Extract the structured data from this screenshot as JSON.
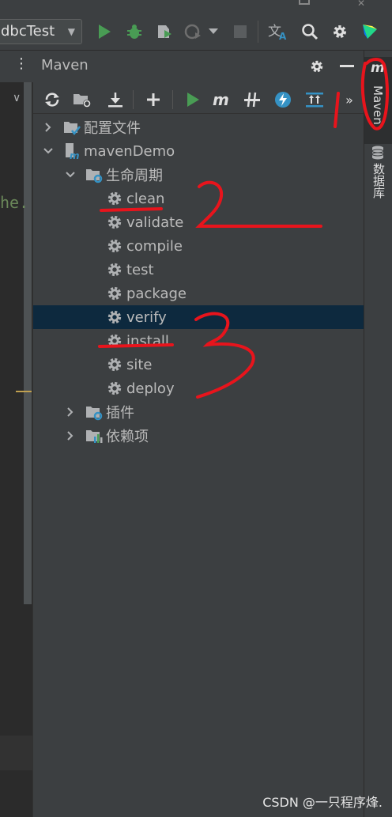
{
  "toolbar": {
    "run_config_label": "dbcTest"
  },
  "editor": {
    "code_fragment": "he."
  },
  "maven_panel": {
    "title": "Maven",
    "tree": [
      {
        "label": "配置文件",
        "level": 0,
        "type": "folder-profiles"
      },
      {
        "label": "mavenDemo",
        "level": 0,
        "type": "project"
      },
      {
        "label": "生命周期",
        "level": 1,
        "type": "folder-lifecycle"
      },
      {
        "label": "clean",
        "level": 2,
        "type": "goal"
      },
      {
        "label": "validate",
        "level": 2,
        "type": "goal"
      },
      {
        "label": "compile",
        "level": 2,
        "type": "goal"
      },
      {
        "label": "test",
        "level": 2,
        "type": "goal"
      },
      {
        "label": "package",
        "level": 2,
        "type": "goal"
      },
      {
        "label": "verify",
        "level": 2,
        "type": "goal",
        "selected": true
      },
      {
        "label": "install",
        "level": 2,
        "type": "goal"
      },
      {
        "label": "site",
        "level": 2,
        "type": "goal"
      },
      {
        "label": "deploy",
        "level": 2,
        "type": "goal"
      },
      {
        "label": "插件",
        "level": 1,
        "type": "folder-plugins"
      },
      {
        "label": "依赖项",
        "level": 1,
        "type": "folder-dependencies"
      }
    ]
  },
  "right_strip": {
    "maven_tab": "Maven",
    "database_tab": "数据库"
  },
  "watermark": "CSDN @一只程序烽.",
  "colors": {
    "panel_bg": "#3c3f41",
    "selection": "#0d293e",
    "annotation_red": "#e8141c",
    "run_green": "#499c54"
  }
}
